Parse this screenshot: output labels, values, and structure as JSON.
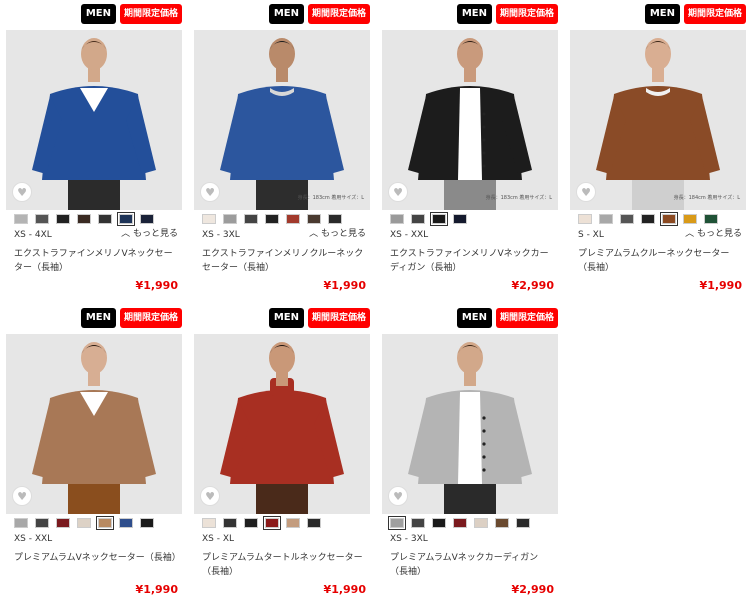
{
  "products": [
    {
      "badge_men": "MEN",
      "badge_sale": "期間限定価格",
      "sizes": "XS - 4XL",
      "more": "もっと見る",
      "name": "エクストラファインメリノVネックセーター（長袖）",
      "price": "¥1,990",
      "size_note": "",
      "swatches": [
        "#b4b4b4",
        "#555555",
        "#222222",
        "#3a2a22",
        "#333333",
        "#1e3458",
        "#1a2238"
      ],
      "selected": 5,
      "photo": {
        "bg": "#e6e6e6",
        "top": "#234f9a",
        "inner": "#ffffff",
        "bottom": "#2b2b2b",
        "skin": "#d2a88a",
        "hair": "#4a2f1e",
        "pose": "vneck"
      }
    },
    {
      "badge_men": "MEN",
      "badge_sale": "期間限定価格",
      "sizes": "XS - 3XL",
      "more": "もっと見る",
      "name": "エクストラファインメリノクルーネックセーター（長袖）",
      "price": "¥1,990",
      "size_note": "身長：183cm 着用サイズ：L",
      "swatches": [
        "#efe7df",
        "#9c9c9c",
        "#444444",
        "#222222",
        "#a23a2c",
        "#4a3a30",
        "#2a2a2a"
      ],
      "selected": -1,
      "photo": {
        "bg": "#e6e6e6",
        "top": "#2c569e",
        "inner": "#d7d7d7",
        "bottom": "#2d2d2d",
        "skin": "#b98a6a",
        "hair": "#1c1c1c",
        "pose": "crew"
      }
    },
    {
      "badge_men": "MEN",
      "badge_sale": "期間限定価格",
      "sizes": "XS - XXL",
      "more": "",
      "name": "エクストラファインメリノVネックカーディガン（長袖）",
      "price": "¥2,990",
      "size_note": "身長：183cm 着用サイズ：L",
      "swatches": [
        "#9a9a9a",
        "#444444",
        "#1a1a1a",
        "#151a2e"
      ],
      "selected": 2,
      "photo": {
        "bg": "#e6e6e6",
        "top": "#1c1c1c",
        "inner": "#ffffff",
        "bottom": "#8a8a8a",
        "skin": "#c99a7c",
        "hair": "#2b1b12",
        "pose": "cardigan"
      }
    },
    {
      "badge_men": "MEN",
      "badge_sale": "期間限定価格",
      "sizes": "S - XL",
      "more": "もっと見る",
      "name": "プレミアムラムクルーネックセーター（長袖）",
      "price": "¥1,990",
      "size_note": "身長：184cm 着用サイズ：L",
      "swatches": [
        "#ede1d6",
        "#a8a8a8",
        "#555555",
        "#222222",
        "#8b4a22",
        "#d99a18",
        "#1f5236"
      ],
      "selected": 4,
      "photo": {
        "bg": "#e6e6e6",
        "top": "#8a4b27",
        "inner": "#f0f0f0",
        "bottom": "#cfcfcf",
        "skin": "#d9ae92",
        "hair": "#3b2616",
        "pose": "crew"
      }
    },
    {
      "badge_men": "MEN",
      "badge_sale": "期間限定価格",
      "sizes": "XS - XXL",
      "more": "",
      "name": "プレミアムラムVネックセーター（長袖）",
      "price": "¥1,990",
      "size_note": "",
      "swatches": [
        "#a8a8a8",
        "#444444",
        "#7a1a1e",
        "#ddd2c6",
        "#b88a62",
        "#2f4e8c",
        "#1a1a1a"
      ],
      "selected": 4,
      "photo": {
        "bg": "#e6e6e6",
        "top": "#a87856",
        "inner": "#ffffff",
        "bottom": "#8a4e1e",
        "skin": "#d7ae93",
        "hair": "#2a1a10",
        "pose": "vneck"
      }
    },
    {
      "badge_men": "MEN",
      "badge_sale": "期間限定価格",
      "sizes": "XS - XL",
      "more": "",
      "name": "プレミアムラムタートルネックセーター（長袖）",
      "price": "¥1,990",
      "size_note": "",
      "swatches": [
        "#ece2d8",
        "#333333",
        "#1f1f1f",
        "#8b1a1a",
        "#c39c7e",
        "#2a2a2a"
      ],
      "selected": 3,
      "photo": {
        "bg": "#e6e6e6",
        "top": "#a82f22",
        "inner": "#a82f22",
        "bottom": "#4a2a1a",
        "skin": "#c99878",
        "hair": "#1e1410",
        "pose": "turtle"
      }
    },
    {
      "badge_men": "MEN",
      "badge_sale": "期間限定価格",
      "sizes": "XS - 3XL",
      "more": "",
      "name": "プレミアムラムVネックカーディガン（長袖）",
      "price": "¥2,990",
      "size_note": "",
      "swatches": [
        "#a0a0a0",
        "#444444",
        "#1a1a1a",
        "#7a1a1e",
        "#dcd0c4",
        "#6a4a30",
        "#2a2a2a"
      ],
      "selected": 0,
      "photo": {
        "bg": "#e6e6e6",
        "top": "#b4b4b4",
        "inner": "#ffffff",
        "bottom": "#2a2a2a",
        "skin": "#d2a88a",
        "hair": "#3a2516",
        "pose": "cardigan"
      }
    }
  ]
}
